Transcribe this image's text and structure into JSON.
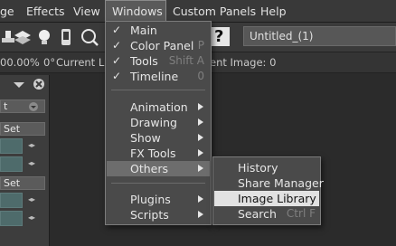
{
  "menubar": {
    "items": [
      "ge",
      "Effects",
      "View",
      "Windows",
      "Custom Panels",
      "Help"
    ]
  },
  "toolbar": {
    "help_glyph": "?",
    "document_name": "Untitled_(1)"
  },
  "status": {
    "zoom": "00.00%",
    "angle": "0°",
    "current_layer": "Current La",
    "current_image": "ent Image: 0"
  },
  "left_panel": {
    "button_1": "t",
    "button_2": "Set",
    "button_3": "Set"
  },
  "windows_menu": {
    "items": [
      {
        "label": "Main",
        "checked": true,
        "shortcut": ""
      },
      {
        "label": "Color Panel",
        "checked": true,
        "shortcut": "P"
      },
      {
        "label": "Tools",
        "checked": true,
        "shortcut": "Shift A"
      },
      {
        "label": "Timeline",
        "checked": true,
        "shortcut": "0"
      },
      {
        "label": "Animation",
        "submenu": true
      },
      {
        "label": "Drawing",
        "submenu": true
      },
      {
        "label": "Show",
        "submenu": true
      },
      {
        "label": "FX Tools",
        "submenu": true
      },
      {
        "label": "Others",
        "submenu": true,
        "highlighted": true
      },
      {
        "label": "Plugins",
        "submenu": true
      },
      {
        "label": "Scripts",
        "submenu": true
      }
    ],
    "check_glyph": "✓"
  },
  "others_menu": {
    "items": [
      {
        "label": "History",
        "shortcut": ""
      },
      {
        "label": "Share Manager",
        "shortcut": ""
      },
      {
        "label": "Image Library",
        "shortcut": "",
        "highlighted": true
      },
      {
        "label": "Search",
        "shortcut": "Ctrl F"
      }
    ]
  },
  "colors": {
    "menubar_bg": "#393939",
    "menu_bg": "#4a4a4a",
    "highlight_bg": "#6d6d6d",
    "selected_bg": "#e2e2e2",
    "shortcut_text": "#7f7f7f"
  }
}
